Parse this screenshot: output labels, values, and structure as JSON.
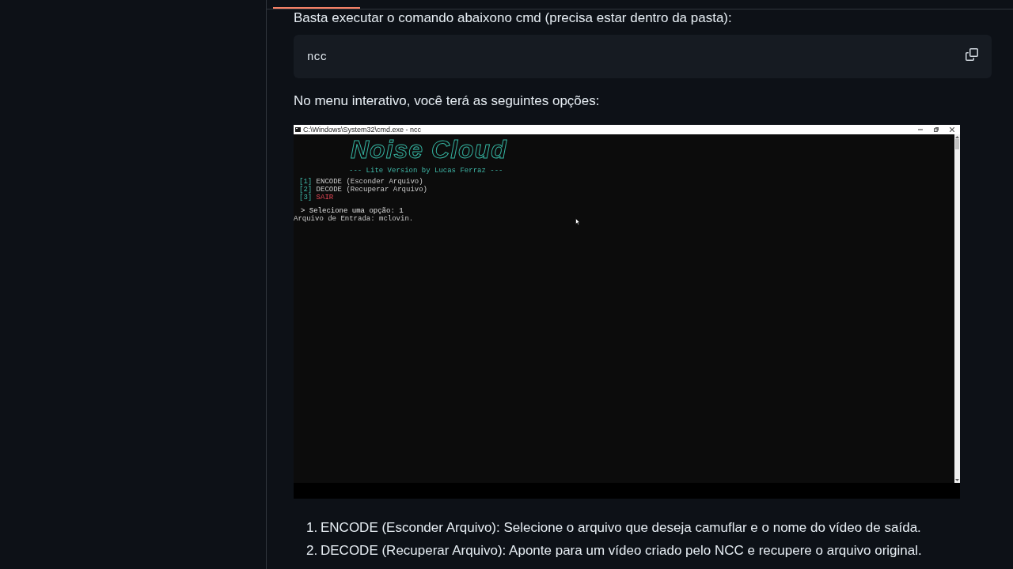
{
  "header": {
    "active_tab_underline": true
  },
  "readme": {
    "intro": "Basta executar o comando abaixono cmd (precisa estar dentro da pasta):",
    "code_block": {
      "code": "ncc"
    },
    "paragraph": "No menu interativo, você terá as seguintes opções:",
    "screenshot": {
      "window_title": "C:\\Windows\\System32\\cmd.exe - ncc",
      "logo": "Noise Cloud",
      "subtitle": "--- Lite Version by Lucas Ferraz ---",
      "menu": [
        {
          "key": "[1]",
          "label": "ENCODE (Esconder Arquivo)",
          "kind": "option"
        },
        {
          "key": "[2]",
          "label": "DECODE (Recuperar Arquivo)",
          "kind": "option"
        },
        {
          "key": "[3]",
          "label": "SAIR",
          "kind": "exit"
        }
      ],
      "prompt": "> Selecione uma opção: 1",
      "output": "Arquivo de Entrada: mclovin."
    },
    "options": [
      {
        "number": "1.",
        "text": "ENCODE (Esconder Arquivo): Selecione o arquivo que deseja camuflar e o nome do vídeo de saída."
      },
      {
        "number": "2.",
        "text": "DECODE (Recuperar Arquivo): Aponte para um vídeo criado pelo NCC e recupere o arquivo original."
      }
    ]
  }
}
